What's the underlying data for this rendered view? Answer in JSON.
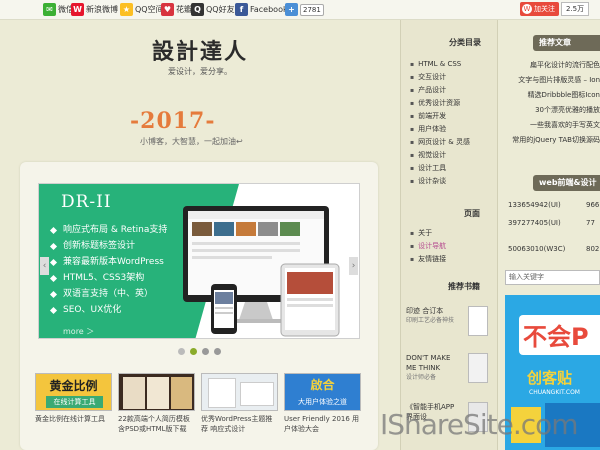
{
  "share": {
    "weixin": "微信",
    "weibo": "新浪微博",
    "qzone": "QQ空间",
    "huaban": "花瓣",
    "qq": "QQ好友",
    "facebook": "Facebook",
    "count": "2781",
    "follow": "加关注",
    "follow_count": "2.5万"
  },
  "site": {
    "logo": "設計達人",
    "slogan": "爱设计，爱分享。",
    "year": "-2017-",
    "year_sub": "小博客，大智慧，一起加油↩"
  },
  "slider": {
    "title": "DR-II",
    "features": [
      "响应式布局 & Retina支持",
      "创新标题标签设计",
      "兼容最新版本WordPress",
      "HTML5、CSS3架构",
      "双语言支持（中、英）",
      "SEO、UX优化"
    ],
    "more": "more ＞",
    "prev": "‹",
    "next": "›",
    "dots": 4,
    "active_dot": 0
  },
  "thumbs": [
    {
      "img_text": "黄金比例",
      "img_sub": "在线计算工具",
      "caption": "黄金比例在线计算工具"
    },
    {
      "img_text": "",
      "img_sub": "",
      "caption": "22款高端个人简历模板含PSD或HTML版下载"
    },
    {
      "img_text": "",
      "img_sub": "",
      "caption": "优秀WordPress主题推荐 响应式设计"
    },
    {
      "img_text": "啟合",
      "img_sub": "大用户体验之道",
      "caption": "User Friendly 2016 用户体验大会"
    }
  ],
  "categories": {
    "heading": "分类目录",
    "items": [
      "HTML & CSS",
      "交互设计",
      "产品设计",
      "优秀设计资源",
      "前端开发",
      "用户体验",
      "网页设计 & 灵感",
      "视觉设计",
      "设计工具",
      "设计杂谈"
    ]
  },
  "pages": {
    "heading": "页面",
    "items": [
      "关于",
      "设计导航",
      "友情链接"
    ]
  },
  "books": {
    "heading": "推荐书籍",
    "items": [
      {
        "title": "印迹 合订本",
        "sub": "印刷工艺必备神技"
      },
      {
        "title": "DON'T MAKE ME THINK",
        "sub": "设计师必备"
      },
      {
        "title": "《智能手机APP界面设",
        "sub": ""
      }
    ]
  },
  "recommended": {
    "heading": "推荐文章",
    "items": [
      "扁平化设计的流行配色",
      "文字与图片排版灵感 – Ion",
      "精选Dribbble图标Icon",
      "30个漂亮优雅的播放",
      "一些我喜欢的手写英文",
      "常用的jQuery TAB切换源码"
    ]
  },
  "qq_groups": {
    "heading": "web前端&设计",
    "rows": [
      [
        "133654942(UI)",
        "966"
      ],
      [
        "397277405(UI)",
        "77"
      ],
      [
        "50063010(W3C)",
        "802"
      ]
    ]
  },
  "search": {
    "placeholder": "输入关键字"
  },
  "ad": {
    "line1": "不会P",
    "line2": "创客贴",
    "line3": "CHUANGKIT.COM"
  },
  "watermark": "IShareSite.com",
  "colors": {
    "background": "#ecebd6",
    "slider_green": "#27b27a",
    "year_orange": "#e57b3c",
    "follow_red": "#e84a3c",
    "ad_blue": "#2ba8e4"
  }
}
